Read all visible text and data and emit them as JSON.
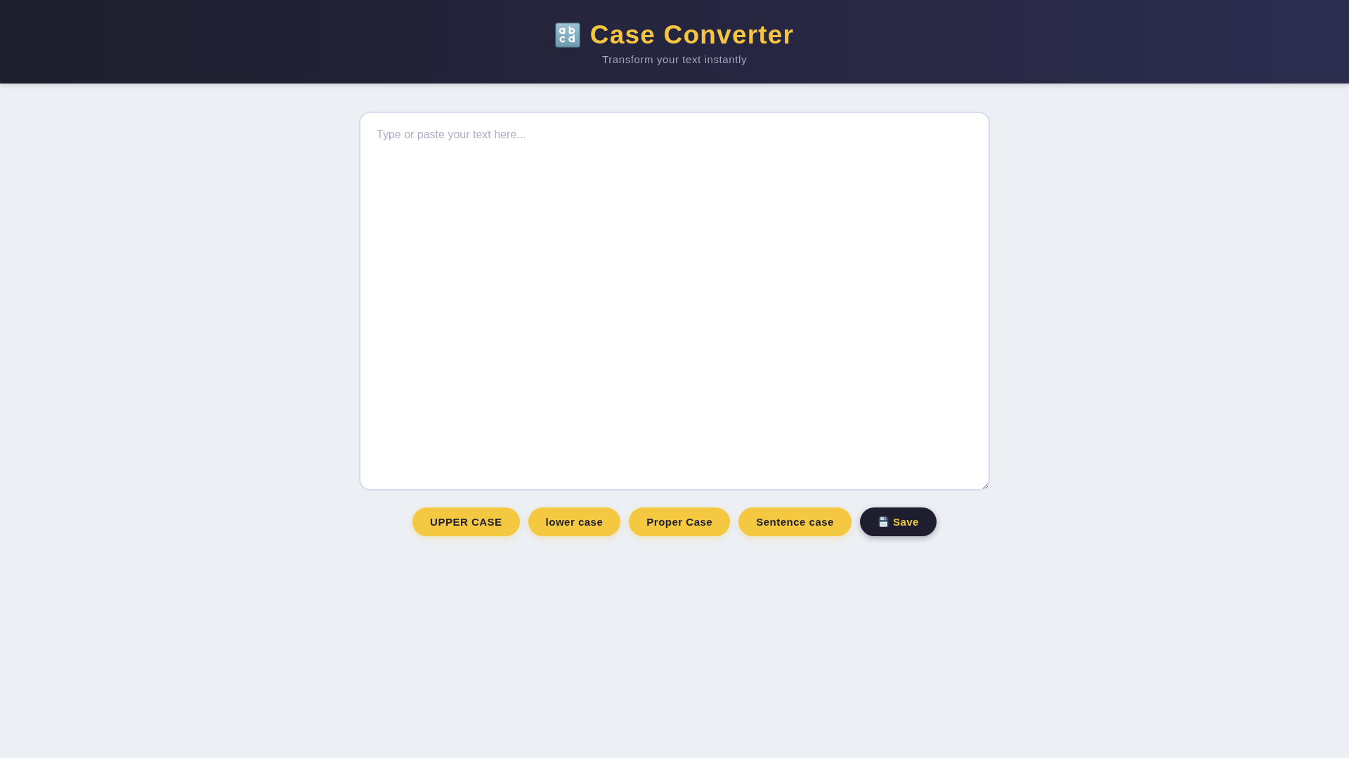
{
  "header": {
    "title": "Case Converter",
    "subtitle": "Transform your text instantly"
  },
  "editor": {
    "placeholder": "Type or paste your text here..."
  },
  "buttons": [
    {
      "label": "UPPER CASE",
      "kind": "convert"
    },
    {
      "label": "lower case",
      "kind": "convert"
    },
    {
      "label": "Proper Case",
      "kind": "convert"
    },
    {
      "label": "Sentence case",
      "kind": "convert"
    },
    {
      "label": "Save",
      "kind": "save"
    }
  ]
}
